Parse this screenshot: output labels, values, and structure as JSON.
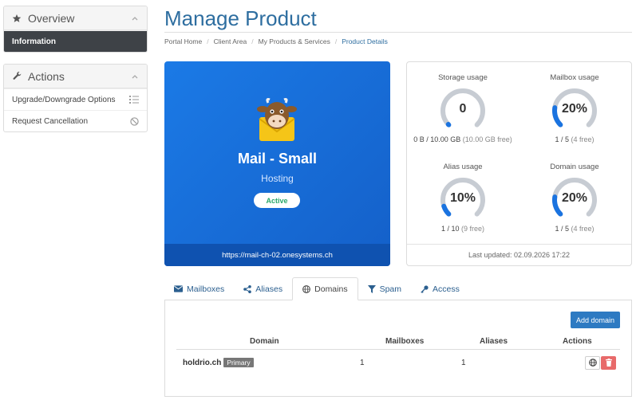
{
  "sidebar": {
    "overview": {
      "title": "Overview",
      "items": [
        {
          "label": "Information"
        }
      ]
    },
    "actions": {
      "title": "Actions",
      "items": [
        {
          "label": "Upgrade/Downgrade Options"
        },
        {
          "label": "Request Cancellation"
        }
      ]
    }
  },
  "page": {
    "title": "Manage Product",
    "breadcrumbs": [
      "Portal Home",
      "Client Area",
      "My Products & Services",
      "Product Details"
    ]
  },
  "product": {
    "name": "Mail - Small",
    "type": "Hosting",
    "status": "Active",
    "url": "https://mail-ch-02.onesystems.ch"
  },
  "usage": {
    "storage": {
      "label": "Storage usage",
      "value_text": "0",
      "fraction": 0.0,
      "used": "0 B / 10.00 GB",
      "free": "(10.00 GB free)"
    },
    "mailbox": {
      "label": "Mailbox usage",
      "value_text": "20%",
      "fraction": 0.2,
      "used": "1 / 5",
      "free": "(4 free)"
    },
    "alias": {
      "label": "Alias usage",
      "value_text": "10%",
      "fraction": 0.1,
      "used": "1 / 10",
      "free": "(9 free)"
    },
    "domain": {
      "label": "Domain usage",
      "value_text": "20%",
      "fraction": 0.2,
      "used": "1 / 5",
      "free": "(4 free)"
    },
    "last_updated": "Last updated: 02.09.2026 17:22"
  },
  "tabs": [
    {
      "label": "Mailboxes",
      "icon": "envelope-icon"
    },
    {
      "label": "Aliases",
      "icon": "share-icon"
    },
    {
      "label": "Domains",
      "icon": "globe-icon",
      "active": true
    },
    {
      "label": "Spam",
      "icon": "filter-icon"
    },
    {
      "label": "Access",
      "icon": "key-icon"
    }
  ],
  "domains": {
    "add_button": "Add domain",
    "columns": {
      "domain": "Domain",
      "mailboxes": "Mailboxes",
      "aliases": "Aliases",
      "actions": "Actions"
    },
    "rows": [
      {
        "domain": "holdrio.ch",
        "badge": "Primary",
        "mailboxes": "1",
        "aliases": "1"
      }
    ]
  },
  "colors": {
    "accent": "#2e6ea0",
    "product_bg": "#1a73e0",
    "gauge_fill": "#1a73e0",
    "gauge_track": "#c7ccd3",
    "status_green": "#2aa86a",
    "danger": "#e86a6a"
  }
}
